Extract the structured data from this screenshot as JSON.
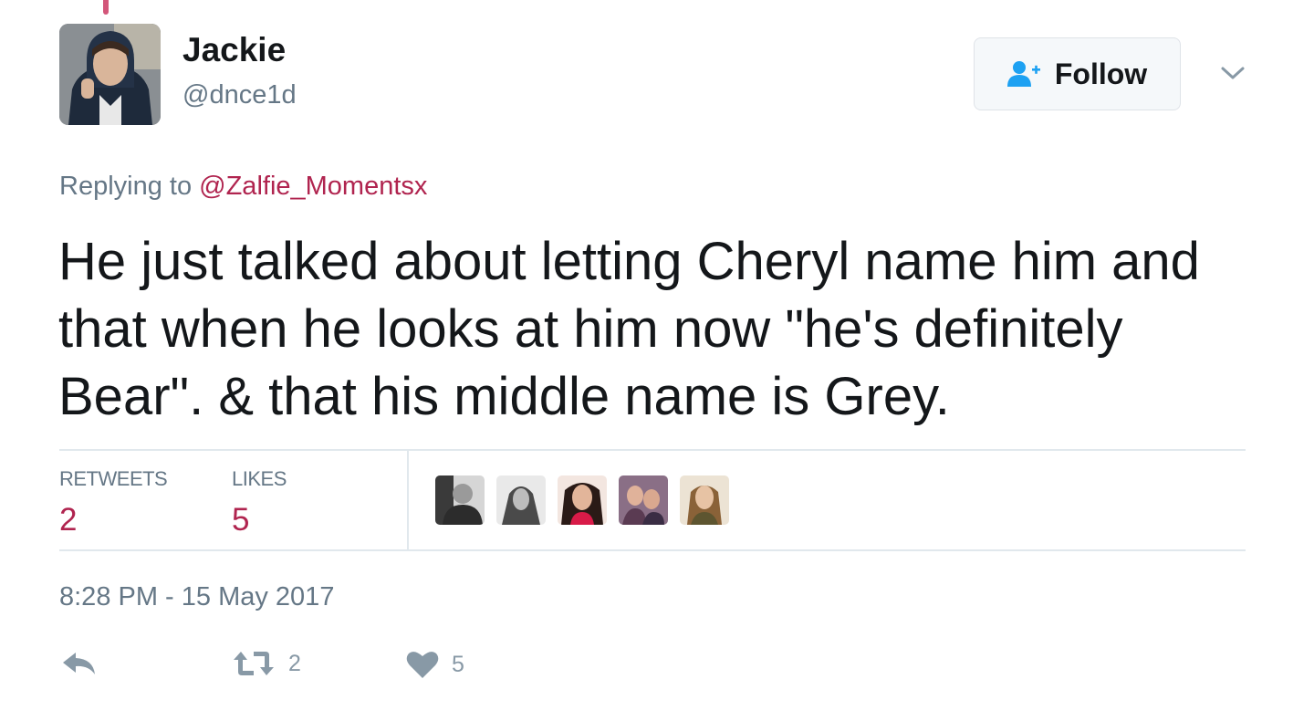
{
  "author": {
    "name": "Jackie",
    "handle": "@dnce1d"
  },
  "follow_button": {
    "label": "Follow",
    "icon": "follow-person-plus-icon"
  },
  "menu": {
    "icon": "chevron-down-icon"
  },
  "reply_context": {
    "prefix": "Replying to ",
    "mention": "@Zalfie_Momentsx"
  },
  "tweet": {
    "text": "He just talked about letting Cheryl name him and that when he looks at him now \"he's definitely Bear\". & that his middle name is Grey.",
    "timestamp": "8:28 PM - 15 May 2017"
  },
  "stats": {
    "retweets_label": "RETWEETS",
    "retweets_value": "2",
    "likes_label": "LIKES",
    "likes_value": "5"
  },
  "likers_count_shown": 5,
  "actions": {
    "reply_icon": "reply-icon",
    "retweet_icon": "retweet-icon",
    "retweet_count": "2",
    "like_icon": "heart-icon",
    "like_count": "5"
  },
  "colors": {
    "accent": "#b0244f",
    "muted": "#657786",
    "text": "#14171a",
    "follow_icon": "#1da1f2",
    "thread_line": "#d3567a"
  }
}
